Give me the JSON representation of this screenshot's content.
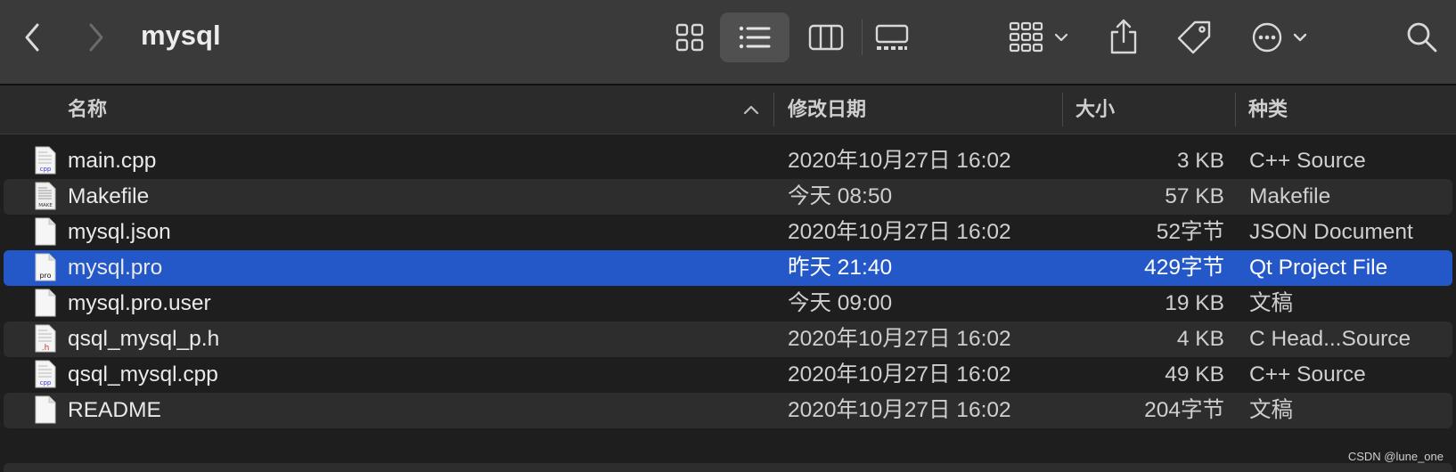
{
  "window": {
    "title": "mysql"
  },
  "toolbar": {
    "back_icon": "chevron-left-icon",
    "forward_icon": "chevron-right-icon",
    "views": [
      "icon-view-icon",
      "list-view-icon",
      "column-view-icon",
      "gallery-view-icon"
    ],
    "active_view": "list-view-icon",
    "actions": [
      "group-by-icon",
      "share-icon",
      "tag-icon",
      "more-actions-icon",
      "search-icon"
    ]
  },
  "columns": {
    "name": "名称",
    "date": "修改日期",
    "size": "大小",
    "kind": "种类"
  },
  "files": [
    {
      "name": "main.cpp",
      "date": "2020年10月27日 16:02",
      "size": "3 KB",
      "kind": "C++ Source",
      "icon": "cpp-file-icon"
    },
    {
      "name": "Makefile",
      "date": "今天 08:50",
      "size": "57 KB",
      "kind": "Makefile",
      "icon": "makefile-icon"
    },
    {
      "name": "mysql.json",
      "date": "2020年10月27日 16:02",
      "size": "52字节",
      "kind": "JSON Document",
      "icon": "document-icon"
    },
    {
      "name": "mysql.pro",
      "date": "昨天 21:40",
      "size": "429字节",
      "kind": "Qt Project File",
      "icon": "pro-file-icon"
    },
    {
      "name": "mysql.pro.user",
      "date": "今天 09:00",
      "size": "19 KB",
      "kind": "文稿",
      "icon": "document-icon"
    },
    {
      "name": "qsql_mysql_p.h",
      "date": "2020年10月27日 16:02",
      "size": "4 KB",
      "kind": "C Head...Source",
      "icon": "header-file-icon"
    },
    {
      "name": "qsql_mysql.cpp",
      "date": "2020年10月27日 16:02",
      "size": "49 KB",
      "kind": "C++ Source",
      "icon": "cpp-file-icon"
    },
    {
      "name": "README",
      "date": "2020年10月27日 16:02",
      "size": "204字节",
      "kind": "文稿",
      "icon": "document-icon"
    }
  ],
  "selected_file": "mysql.pro",
  "watermark": "CSDN @lune_one",
  "colors": {
    "selection": "#2458c8",
    "toolbar": "#3a3a3a",
    "background": "#1e1e1e"
  }
}
